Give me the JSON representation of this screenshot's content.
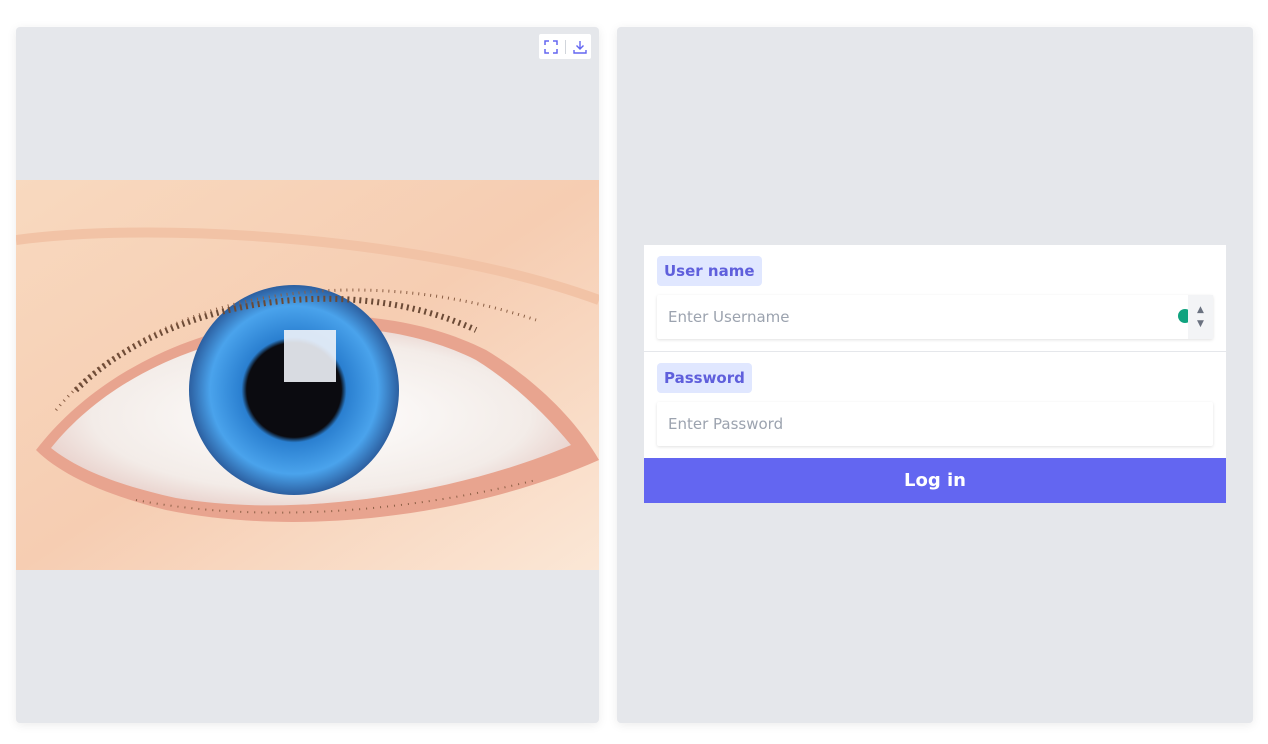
{
  "image_panel": {
    "image_alt": "blue eye close-up",
    "toolbar": {
      "fullscreen_icon": "fullscreen-icon",
      "download_icon": "download-icon"
    }
  },
  "login_form": {
    "username": {
      "label": "User name",
      "placeholder": "Enter Username",
      "value": ""
    },
    "password": {
      "label": "Password",
      "placeholder": "Enter Password",
      "value": ""
    },
    "submit_label": "Log in"
  },
  "colors": {
    "accent": "#6366f1",
    "label_bg": "#e0e7ff",
    "panel_bg": "#e5e7eb",
    "status_dot": "#10a37f"
  }
}
